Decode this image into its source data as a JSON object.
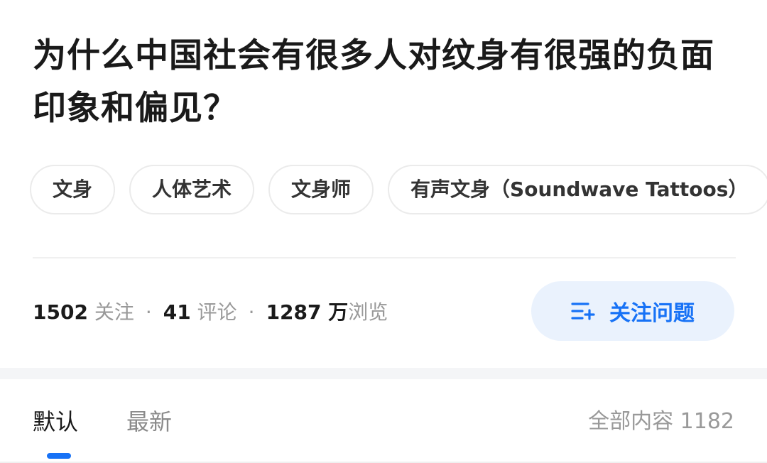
{
  "question": {
    "title": "为什么中国社会有很多人对纹身有很强的负面印象和偏见？"
  },
  "tags": [
    {
      "label": "文身"
    },
    {
      "label": "人体艺术"
    },
    {
      "label": "文身师"
    },
    {
      "label": "有声文身（Soundwave Tattoos）"
    }
  ],
  "stats": {
    "followers_count": "1502",
    "followers_label": "关注",
    "comments_count": "41",
    "comments_label": "评论",
    "views_count": "1287 万",
    "views_label": "浏览",
    "separator": "·"
  },
  "follow_button": {
    "label": "关注问题",
    "icon": "list-add-icon",
    "color": "#1772f6",
    "background": "#eaf2fd"
  },
  "sort_tabs": [
    {
      "label": "默认",
      "active": true
    },
    {
      "label": "最新",
      "active": false
    }
  ],
  "answers": {
    "total_label": "全部内容 1182"
  },
  "colors": {
    "accent": "#1772f6",
    "text_primary": "#1a1a1a",
    "text_secondary": "#999999"
  }
}
